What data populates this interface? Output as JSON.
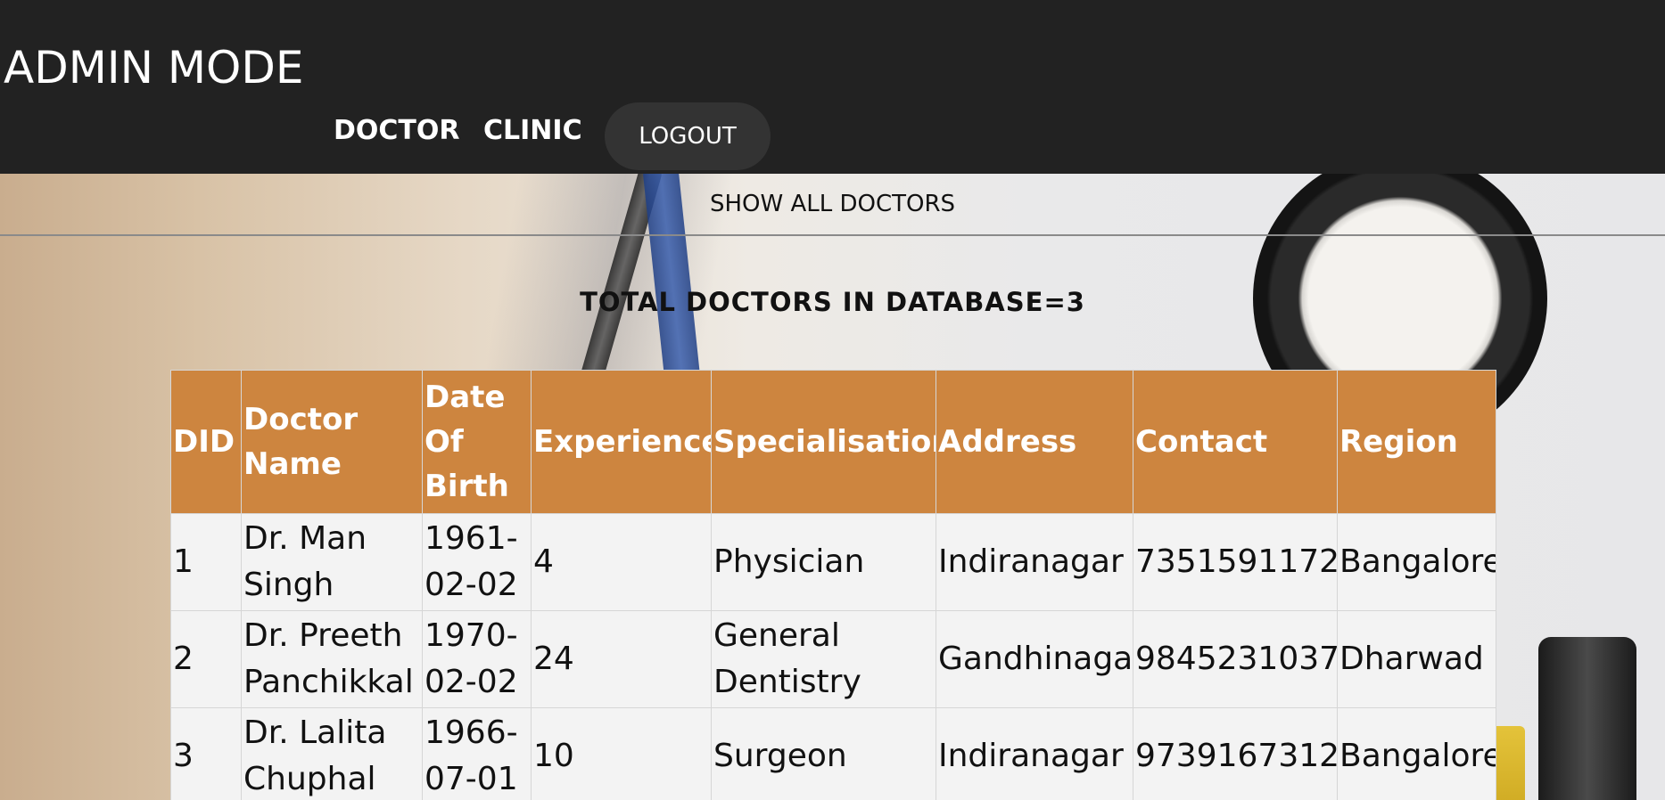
{
  "header": {
    "title": "ADMIN MODE",
    "nav": {
      "doctor_label": "DOCTOR",
      "clinic_label": "CLINIC",
      "logout_label": "LOGOUT"
    }
  },
  "section": {
    "title": "SHOW ALL DOCTORS",
    "total_text": "TOTAL DOCTORS IN DATABASE=3"
  },
  "table": {
    "columns": [
      "DID",
      "Doctor Name",
      "Date Of Birth",
      "Experience",
      "Specialisation",
      "Address",
      "Contact",
      "Region"
    ],
    "rows": [
      [
        "1",
        "Dr. Man Singh",
        "1961-\n02-02",
        "4",
        "Physician",
        "Indiranagar",
        "7351591172",
        "Bangalore"
      ],
      [
        "2",
        "Dr. Preeth Panchikkal",
        "1970-\n02-02",
        "24",
        "General Dentistry",
        "Gandhinagar",
        "9845231037",
        "Dharwad"
      ],
      [
        "3",
        "Dr. Lalita Chuphal",
        "1966-\n07-01",
        "10",
        "Surgeon",
        "Indiranagar",
        "9739167312",
        "Bangalore"
      ]
    ]
  },
  "colors": {
    "header_bg": "#222222",
    "table_header_bg": "#cd853f",
    "table_row_bg": "#f3f3f3"
  }
}
